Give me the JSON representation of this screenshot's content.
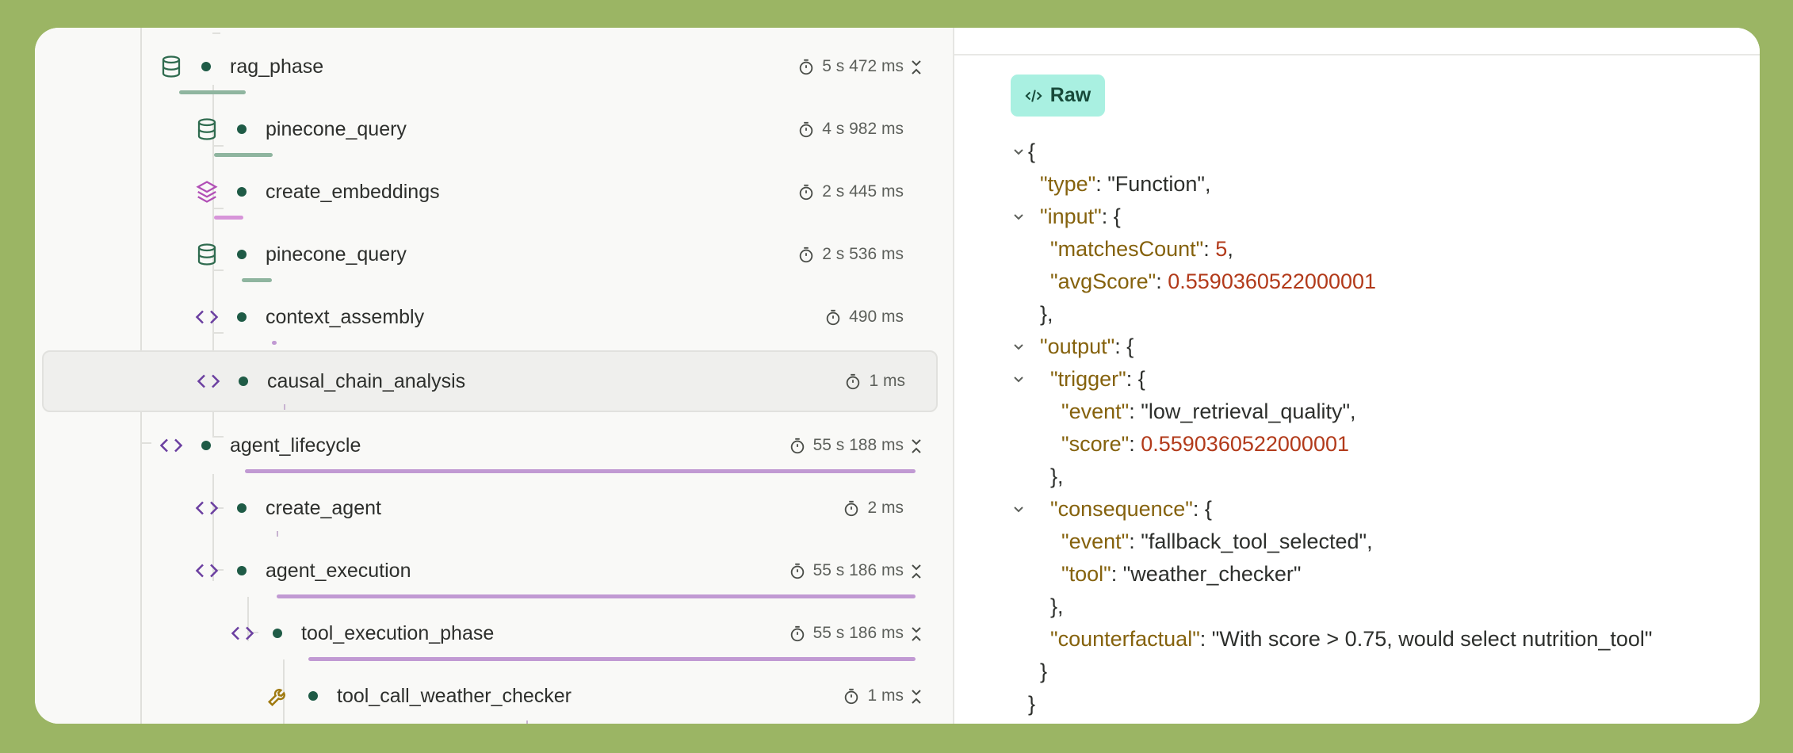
{
  "trace": {
    "rows": [
      {
        "name": "rag_phase",
        "duration": "5 s 472 ms",
        "icon": "database-icon",
        "collapsible": true
      },
      {
        "name": "pinecone_query",
        "duration": "4 s 982 ms",
        "icon": "database-icon",
        "collapsible": false
      },
      {
        "name": "create_embeddings",
        "duration": "2 s 445 ms",
        "icon": "layers-icon",
        "collapsible": false
      },
      {
        "name": "pinecone_query",
        "duration": "2 s 536 ms",
        "icon": "database-icon",
        "collapsible": false
      },
      {
        "name": "context_assembly",
        "duration": "490 ms",
        "icon": "code-icon",
        "collapsible": false
      },
      {
        "name": "causal_chain_analysis",
        "duration": "1 ms",
        "icon": "code-icon",
        "collapsible": false,
        "selected": true
      },
      {
        "name": "agent_lifecycle",
        "duration": "55 s 188 ms",
        "icon": "code-icon",
        "collapsible": true
      },
      {
        "name": "create_agent",
        "duration": "2 ms",
        "icon": "code-icon",
        "collapsible": false
      },
      {
        "name": "agent_execution",
        "duration": "55 s 186 ms",
        "icon": "code-icon",
        "collapsible": true
      },
      {
        "name": "tool_execution_phase",
        "duration": "55 s 186 ms",
        "icon": "code-icon",
        "collapsible": true
      },
      {
        "name": "tool_call_weather_checker",
        "duration": "1 ms",
        "icon": "wrench-icon",
        "collapsible": true
      }
    ]
  },
  "detail": {
    "raw_label": "Raw",
    "json_lines": {
      "l1": "{",
      "l2_key": "\"type\"",
      "l2_val": "\"Function\"",
      "l3_key": "\"input\"",
      "l4_key": "\"matchesCount\"",
      "l4_val": "5",
      "l5_key": "\"avgScore\"",
      "l5_val": "0.5590360522000001",
      "l7_key": "\"output\"",
      "l8_key": "\"trigger\"",
      "l9_key": "\"event\"",
      "l9_val": "\"low_retrieval_quality\"",
      "l10_key": "\"score\"",
      "l10_val": "0.5590360522000001",
      "l12_key": "\"consequence\"",
      "l13_key": "\"event\"",
      "l13_val": "\"fallback_tool_selected\"",
      "l14_key": "\"tool\"",
      "l14_val": "\"weather_checker\"",
      "l16_key": "\"counterfactual\"",
      "l16_val": "\"With score > 0.75, would select nutrition_tool\""
    }
  },
  "colors": {
    "background": "#9bb564",
    "accent_teal": "#a9f0e1",
    "json_key": "#85620d",
    "json_number": "#b23a1a",
    "node_green": "#1f5b46",
    "code_icon_purple": "#6b3fa0"
  }
}
